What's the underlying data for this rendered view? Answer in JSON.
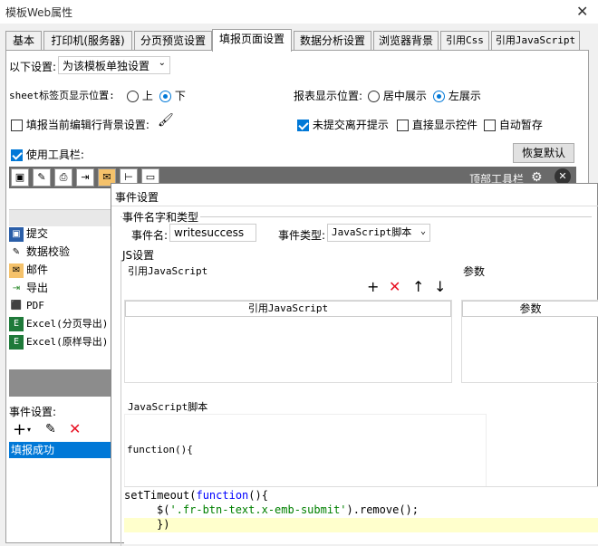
{
  "window": {
    "title": "模板Web属性",
    "close_label": "✕"
  },
  "tabs": [
    {
      "label": "基本"
    },
    {
      "label": "打印机(服务器)"
    },
    {
      "label": "分页预览设置"
    },
    {
      "label": "填报页面设置"
    },
    {
      "label": "数据分析设置"
    },
    {
      "label": "浏览器背景"
    },
    {
      "label": "引用Css"
    },
    {
      "label": "引用JavaScript"
    }
  ],
  "settings": {
    "mode_label": "以下设置:",
    "mode_value": "为该模板单独设置",
    "sheet_pos_label": "sheet标签页显示位置:",
    "sheet_pos_options": [
      "上",
      "下"
    ],
    "report_pos_label": "报表显示位置:",
    "report_pos_options": [
      "居中展示",
      "左展示"
    ],
    "fill_bg_label": "填报当前编辑行背景设置:",
    "unsubmitted_label": "未提交离开提示",
    "show_control_label": "直接显示控件",
    "autosave_label": "自动暂存",
    "use_toolbar_label": "使用工具栏:",
    "restore_label": "恢复默认",
    "top_toolbar_label": "顶部工具栏"
  },
  "toolbar_items": [
    {
      "label": "提交",
      "icon": "save-icon"
    },
    {
      "label": "数据校验",
      "icon": "pencil-icon"
    },
    {
      "label": "邮件",
      "icon": "mail-icon"
    },
    {
      "label": "导出",
      "icon": "export-icon"
    },
    {
      "label": "PDF",
      "icon": "pdf-icon"
    },
    {
      "label": "Excel(分页导出)",
      "icon": "excel-icon"
    },
    {
      "label": "Excel(原样导出)",
      "icon": "excel-icon"
    }
  ],
  "events": {
    "label": "事件设置:",
    "items": [
      {
        "label": "填报成功"
      }
    ]
  },
  "dialog": {
    "title": "事件设置",
    "group_name_type": "事件名字和类型",
    "name_label": "事件名:",
    "name_value": "writesuccess",
    "type_label": "事件类型:",
    "type_value": "JavaScript脚本",
    "js_group": "JS设置",
    "ref_js_label": "引用JavaScript",
    "params_label": "参数",
    "ref_js_col": "引用JavaScript",
    "params_col": "参数",
    "script_label": "JavaScript脚本",
    "func_header": "function(){",
    "code": {
      "l1_kw": "setTimeout",
      "l1_paren": "(",
      "l1_fn": "function",
      "l1_end": "(){",
      "l2_a": "$(",
      "l2_str": "'.fr-btn-text.x-emb-submit'",
      "l2_b": ").remove();",
      "l3": "})"
    }
  },
  "colors": {
    "accent": "#0078d7",
    "delete": "#e81123",
    "highlight": "#ffffcc"
  }
}
